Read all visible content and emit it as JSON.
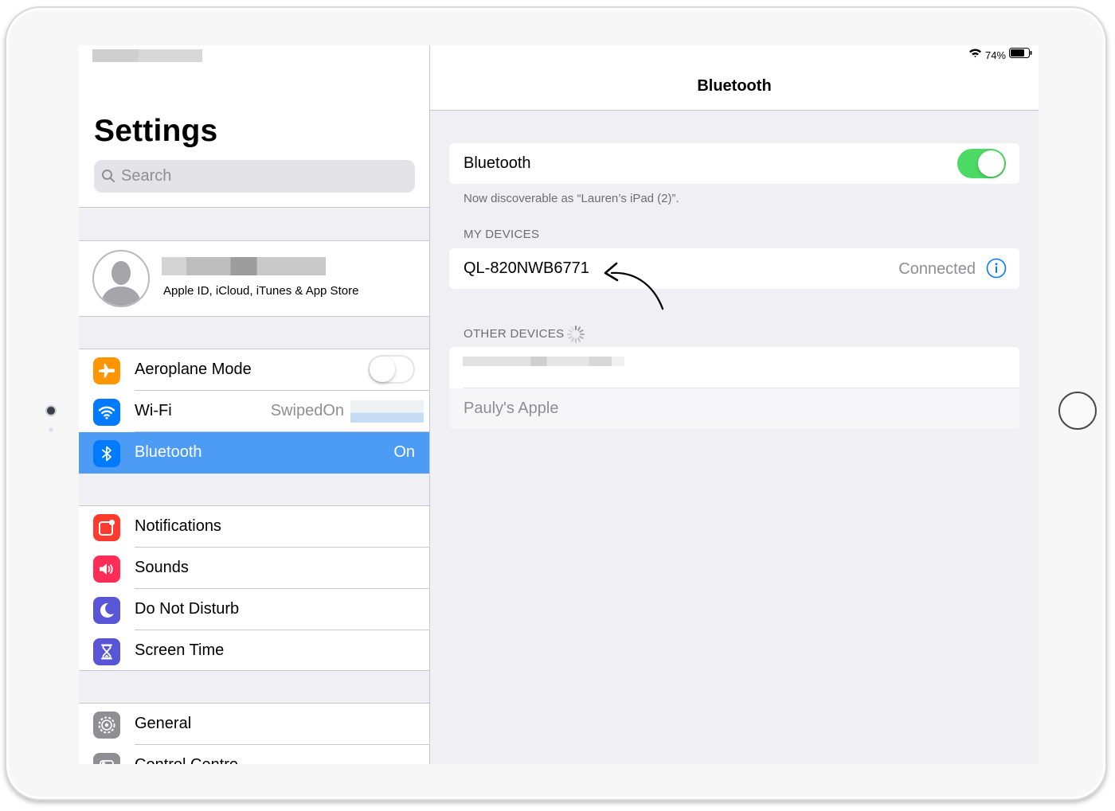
{
  "sidebar": {
    "title": "Settings",
    "search": {
      "placeholder": "Search"
    },
    "profile": {
      "subtitle": "Apple ID, iCloud, iTunes & App Store"
    },
    "group1": [
      {
        "label": "Aeroplane Mode",
        "icon": "airplane-icon",
        "color": "#ff9500"
      },
      {
        "label": "Wi-Fi",
        "value": "SwipedOn",
        "icon": "wifi-icon",
        "color": "#007aff"
      },
      {
        "label": "Bluetooth",
        "value": "On",
        "icon": "bluetooth-icon",
        "color": "#007aff",
        "selected": true
      }
    ],
    "group2": [
      {
        "label": "Notifications",
        "icon": "notifications-icon",
        "color": "#ff3b30"
      },
      {
        "label": "Sounds",
        "icon": "sounds-icon",
        "color": "#ff2d55"
      },
      {
        "label": "Do Not Disturb",
        "icon": "moon-icon",
        "color": "#5856d6"
      },
      {
        "label": "Screen Time",
        "icon": "hourglass-icon",
        "color": "#5856d6"
      }
    ],
    "group3": [
      {
        "label": "General",
        "icon": "gear-icon",
        "color": "#8e8e93"
      },
      {
        "label": "Control Centre",
        "icon": "control-centre-icon",
        "color": "#8e8e93"
      }
    ]
  },
  "status_bar": {
    "battery_percent": "74%"
  },
  "detail": {
    "nav_title": "Bluetooth",
    "bluetooth_row_label": "Bluetooth",
    "bluetooth_enabled": true,
    "discoverable_text": "Now discoverable as “Lauren’s iPad (2)”.",
    "my_devices_header": "MY DEVICES",
    "my_devices": [
      {
        "name": "QL-820NWB6771",
        "status": "Connected"
      }
    ],
    "other_devices_header": "OTHER DEVICES",
    "other_devices": [
      {
        "name": "Pauly's Apple"
      }
    ]
  },
  "colors": {
    "accent": "#007aff",
    "selection": "#4c9cf5",
    "toggle_on": "#4cd964",
    "grouped_background": "#efeff4"
  }
}
